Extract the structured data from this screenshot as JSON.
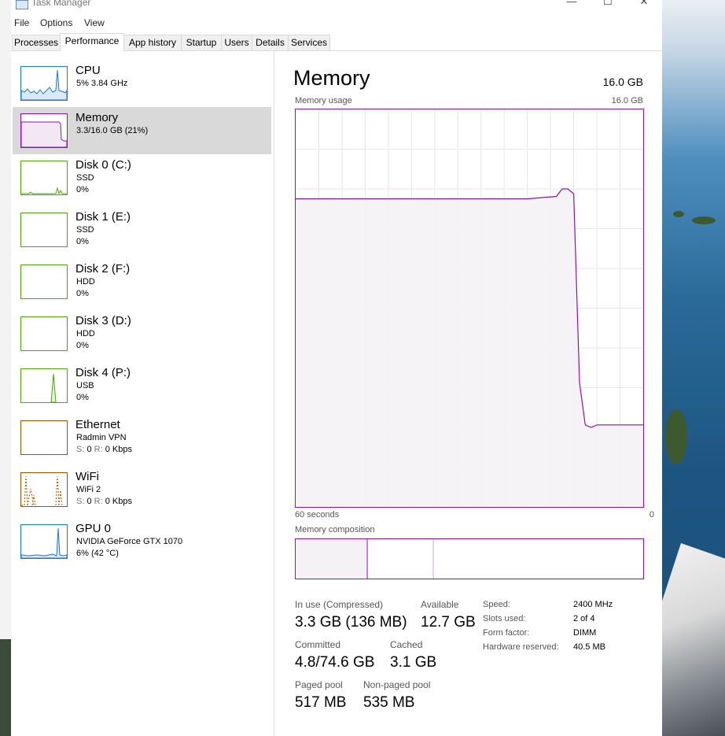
{
  "window": {
    "title": "Task Manager"
  },
  "menu": [
    "File",
    "Options",
    "View"
  ],
  "tabs": [
    "Processes",
    "Performance",
    "App history",
    "Startup",
    "Users",
    "Details",
    "Services"
  ],
  "active_tab": "Performance",
  "resources": [
    {
      "name": "CPU",
      "sub": "5%  3.84 GHz",
      "sub2": "",
      "color": "#1979ca",
      "icon": "cpu-graph-icon"
    },
    {
      "name": "Memory",
      "sub": "3.3/16.0 GB (21%)",
      "sub2": "",
      "color": "#8b12ae",
      "icon": "memory-graph-icon"
    },
    {
      "name": "Disk 0 (C:)",
      "sub": "SSD",
      "sub2": "0%",
      "color": "#4da60c",
      "icon": "disk-graph-icon"
    },
    {
      "name": "Disk 1 (E:)",
      "sub": "SSD",
      "sub2": "0%",
      "color": "#4da60c",
      "icon": "disk-graph-icon"
    },
    {
      "name": "Disk 2 (F:)",
      "sub": "HDD",
      "sub2": "0%",
      "color": "#4da60c",
      "icon": "disk-graph-icon"
    },
    {
      "name": "Disk 3 (D:)",
      "sub": "HDD",
      "sub2": "0%",
      "color": "#4da60c",
      "icon": "disk-graph-icon"
    },
    {
      "name": "Disk 4 (P:)",
      "sub": "USB",
      "sub2": "0%",
      "color": "#4da60c",
      "icon": "disk-graph-icon"
    },
    {
      "name": "Ethernet",
      "sub": "Radmin VPN",
      "sub2_s": "S: ",
      "sub2_sv": "0",
      "sub2_r": "R: ",
      "sub2_rv": "0 Kbps",
      "color": "#a74f01",
      "icon": "ethernet-graph-icon"
    },
    {
      "name": "WiFi",
      "sub": "WiFi 2",
      "sub2_s": "S: ",
      "sub2_sv": "0",
      "sub2_r": "R: ",
      "sub2_rv": "0 Kbps",
      "color": "#a74f01",
      "icon": "wifi-graph-icon"
    },
    {
      "name": "GPU 0",
      "sub": "NVIDIA GeForce GTX 1070",
      "sub2": "6%  (42 °C)",
      "color": "#1979ca",
      "icon": "gpu-graph-icon"
    }
  ],
  "memory": {
    "title": "Memory",
    "total": "16.0 GB",
    "usage_label": "Memory usage",
    "usage_max": "16.0 GB",
    "time_left": "60 seconds",
    "time_right": "0",
    "composition_label": "Memory composition",
    "stats": {
      "in_use_label": "In use (Compressed)",
      "in_use_value": "3.3 GB (136 MB)",
      "available_label": "Available",
      "available_value": "12.7 GB",
      "committed_label": "Committed",
      "committed_value": "4.8/74.6 GB",
      "cached_label": "Cached",
      "cached_value": "3.1 GB",
      "paged_label": "Paged pool",
      "paged_value": "517 MB",
      "nonpaged_label": "Non-paged pool",
      "nonpaged_value": "535 MB"
    },
    "details": [
      {
        "label": "Speed:",
        "value": "2400 MHz"
      },
      {
        "label": "Slots used:",
        "value": "2 of 4"
      },
      {
        "label": "Form factor:",
        "value": "DIMM"
      },
      {
        "label": "Hardware reserved:",
        "value": "40.5 MB"
      }
    ],
    "accent": "#8b12ae",
    "fill": "#f4f2f4"
  },
  "chart_data": {
    "type": "area",
    "title": "Memory usage",
    "xlabel": "",
    "ylabel": "",
    "x_range_seconds": [
      60,
      0
    ],
    "ylim_gb": [
      0,
      16.0
    ],
    "series": [
      {
        "x": [
          60,
          55,
          50,
          45,
          40,
          35,
          30,
          25,
          20,
          15,
          14,
          13,
          12,
          11,
          10,
          9,
          8,
          7,
          6,
          5,
          4,
          3,
          2,
          1,
          0
        ],
        "values": [
          12.4,
          12.4,
          12.4,
          12.4,
          12.4,
          12.4,
          12.4,
          12.4,
          12.4,
          12.5,
          12.8,
          12.8,
          12.6,
          5.0,
          3.3,
          3.2,
          3.3,
          3.3,
          3.3,
          3.3,
          3.3,
          3.3,
          3.3,
          3.3,
          3.3
        ]
      }
    ],
    "composition_fractions": {
      "in_use": 0.206,
      "modified": 0.19,
      "standby": 0.604
    }
  }
}
